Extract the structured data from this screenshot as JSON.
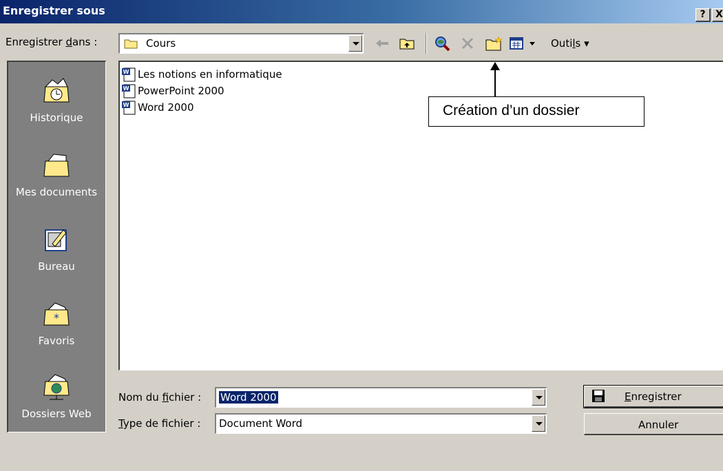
{
  "window": {
    "title": "Enregistrer sous",
    "help_btn": "?",
    "close_btn": "X"
  },
  "lookin": {
    "label_prefix": "Enregistrer ",
    "label_accel": "d",
    "label_suffix": "ans :",
    "value": "Cours"
  },
  "toolbar": {
    "tools_prefix": "Outi",
    "tools_accel": "l",
    "tools_suffix": "s",
    "tools_arrow": "▾",
    "icons": [
      "back-icon",
      "up-folder-icon",
      "search-web-icon",
      "delete-icon",
      "new-folder-icon",
      "views-icon",
      "tools-menu"
    ]
  },
  "places": [
    {
      "label": "Historique",
      "icon": "history-icon"
    },
    {
      "label": "Mes documents",
      "icon": "my-documents-icon"
    },
    {
      "label": "Bureau",
      "icon": "desktop-icon"
    },
    {
      "label": "Favoris",
      "icon": "favorites-icon"
    },
    {
      "label": "Dossiers Web",
      "icon": "web-folders-icon"
    }
  ],
  "files": [
    {
      "name": "Les notions en informatique",
      "icon": "word-document-icon"
    },
    {
      "name": "PowerPoint 2000",
      "icon": "word-document-icon"
    },
    {
      "name": "Word 2000",
      "icon": "word-document-icon"
    }
  ],
  "annotation": {
    "text": "Création d’un dossier"
  },
  "filename": {
    "label_prefix": "Nom du ",
    "label_accel": "f",
    "label_suffix": "ichier :",
    "value": "Word 2000"
  },
  "filetype": {
    "label_accel": "T",
    "label_suffix": "ype de fichier :",
    "value": "Document Word"
  },
  "buttons": {
    "save_accel": "E",
    "save_suffix": "nregistrer",
    "cancel": "Annuler"
  },
  "colors": {
    "title_bar": "#0a246a",
    "dialog_bg": "#d4d0c8",
    "places_bg": "#808080",
    "selection": "#0a246a"
  }
}
